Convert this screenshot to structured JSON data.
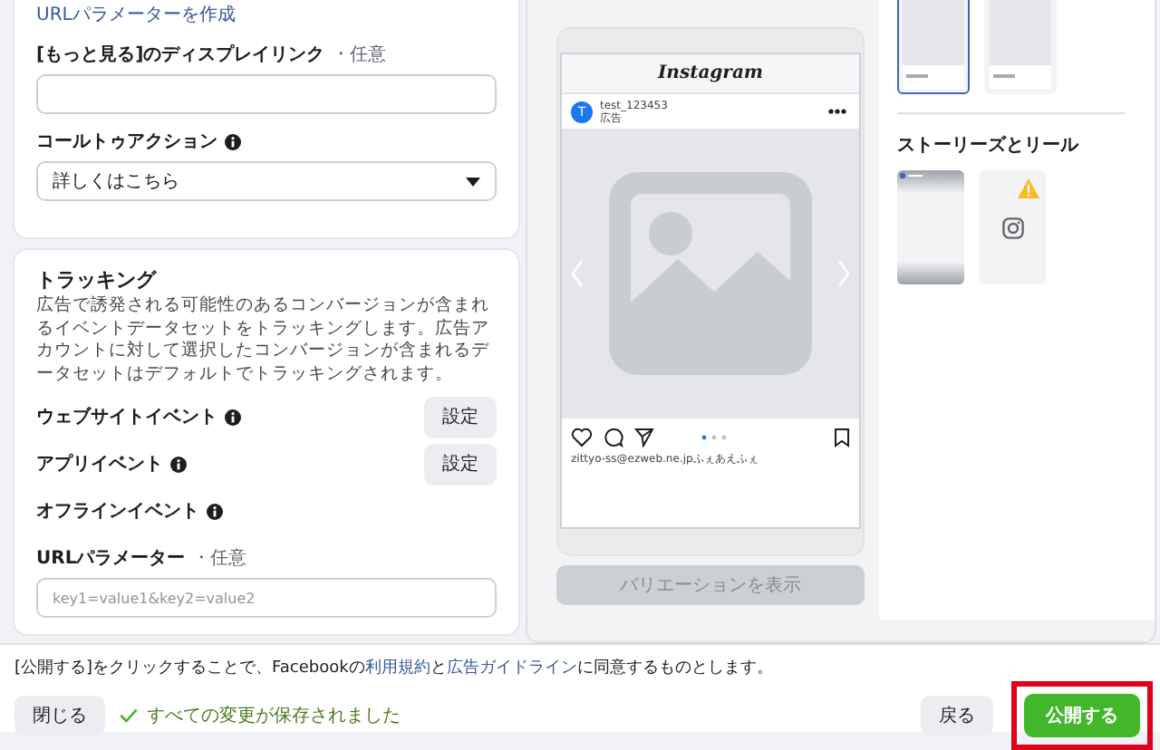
{
  "settings_panel": {
    "create_link": "URLパラメーターを作成",
    "display_link": {
      "label": "[もっと見る]のディスプレイリンク",
      "optional": "・任意"
    },
    "call_to_action": {
      "label": "コールトゥアクション",
      "value": "詳しくはこちら"
    },
    "tracking": {
      "title": "トラッキング",
      "description": "広告で誘発される可能性のあるコンバージョンが含まれるイベントデータセットをトラッキングします。広告アカウントに対して選択したコンバージョンが含まれるデータセットはデフォルトでトラッキングされます。",
      "events": [
        {
          "label": "ウェブサイトイベント",
          "button": "設定"
        },
        {
          "label": "アプリイベント",
          "button": "設定"
        },
        {
          "label": "オフラインイベント"
        }
      ],
      "url_parameters": {
        "label": "URLパラメーター",
        "optional": "・任意",
        "placeholder": "key1=value1&key2=value2"
      }
    }
  },
  "preview": {
    "app_name": "Instagram",
    "avatar_initial": "T",
    "account": "test_123453",
    "sponsored": "広告",
    "caption": "zittyo-ss@ezweb.ne.jpふぇあえふぇ",
    "variations_button": {
      "label": "バリエーションを表示",
      "disabled": true
    }
  },
  "placements": {
    "feed_thumbnails": [
      {
        "selected": true
      },
      {
        "selected": false
      }
    ],
    "stories_heading": "ストーリーズとリール",
    "story_thumbnails": [
      {
        "kind": "preview"
      },
      {
        "kind": "warning"
      }
    ]
  },
  "footer": {
    "notice_start": "[公開する]をクリックすることで、Facebookの",
    "terms_link": "利用規約",
    "notice_joiner": "と",
    "guidelines_link": "広告ガイドライン",
    "notice_end": "に同意するものとします。",
    "close_button": "閉じる",
    "saved_status": "すべての変更が保存されました",
    "back_button": "戻る",
    "publish_button": "公開する"
  }
}
